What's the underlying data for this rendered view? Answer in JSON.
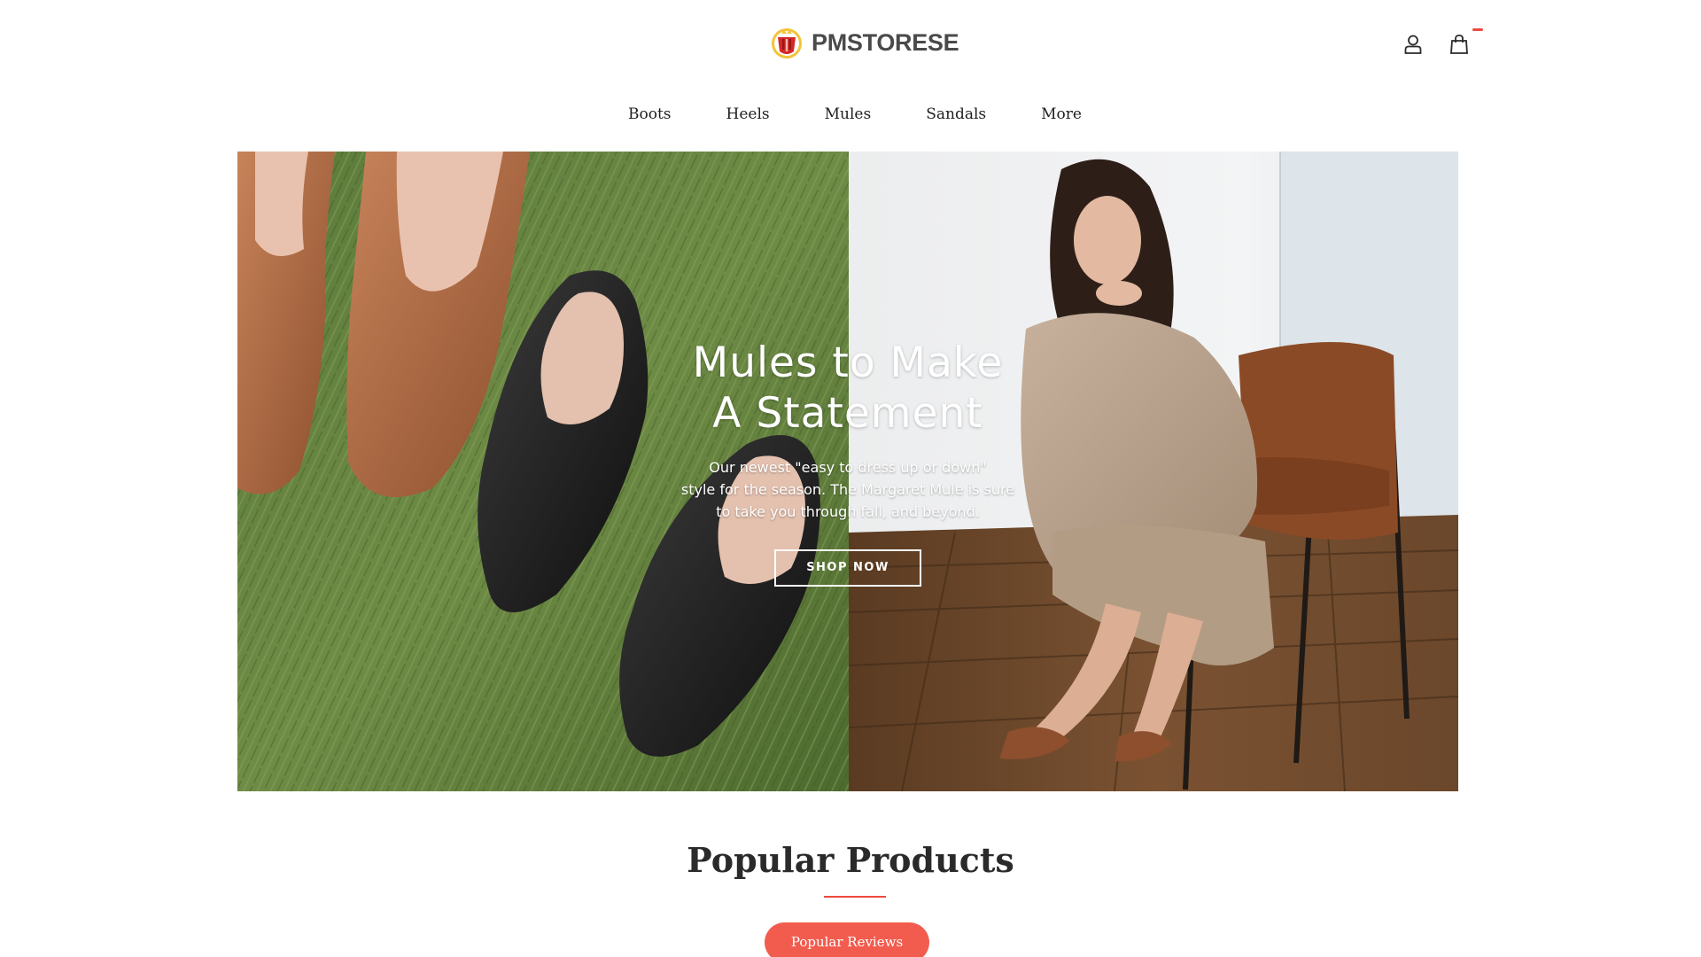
{
  "header": {
    "logo_text": "PMSTORESE",
    "icons": [
      "account-icon",
      "shopping-bag-icon"
    ]
  },
  "nav": {
    "items": [
      "Boots",
      "Heels",
      "Mules",
      "Sandals",
      "More"
    ]
  },
  "hero": {
    "title_line1": "Mules to Make",
    "title_line2": "A Statement",
    "subtitle_line1": "Our newest \"easy to dress up or down\"",
    "subtitle_line2": "style for the season. The Margaret Mule is sure",
    "subtitle_line3": "to take you through fall, and beyond.",
    "cta_label": "SHOP NOW"
  },
  "popular": {
    "title": "Popular Products",
    "tab_label": "Popular Reviews"
  },
  "colors": {
    "accent": "#f25c4e",
    "underline": "#ef4a3f",
    "text": "#1f1f1f"
  }
}
